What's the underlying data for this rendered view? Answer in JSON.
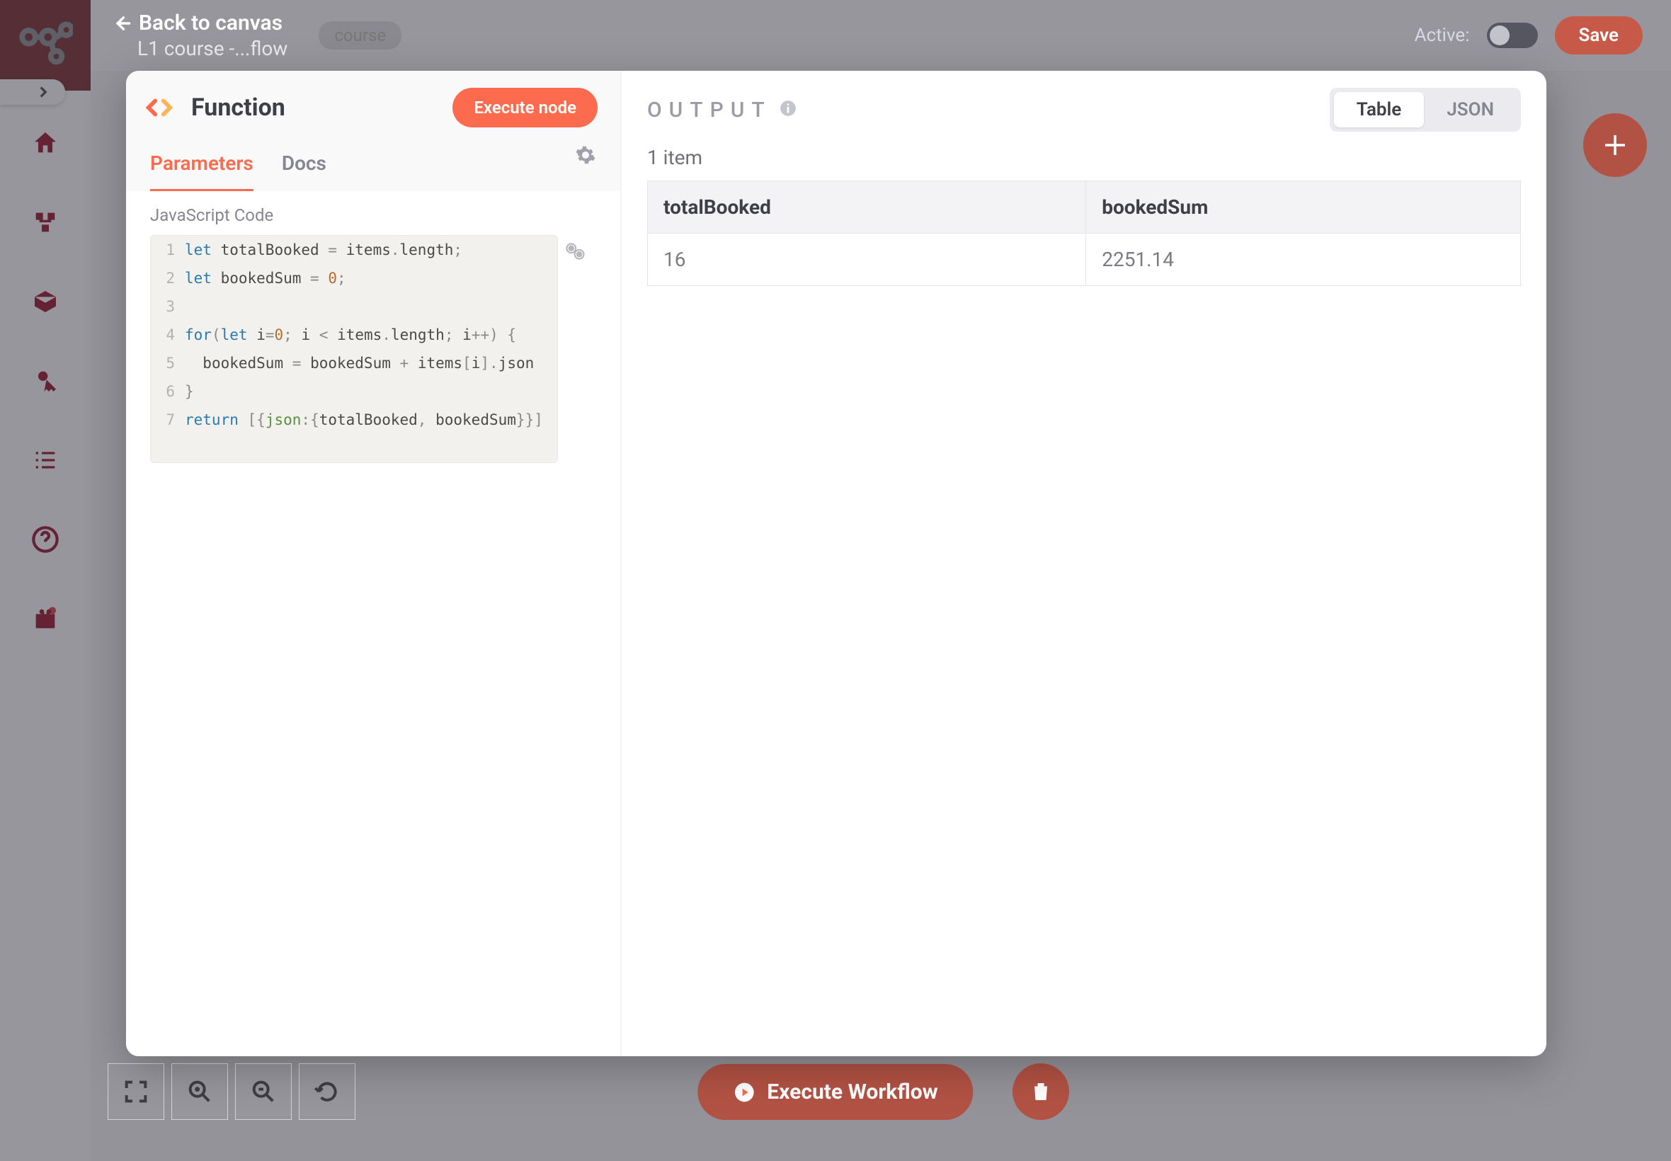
{
  "sidebar": {
    "items": [
      "home",
      "workflows",
      "packages",
      "credentials",
      "list",
      "help",
      "gift"
    ]
  },
  "topbar": {
    "back_label": "Back to canvas",
    "workflow_title": "L1 course -...flow",
    "tag": "course",
    "active_label": "Active:",
    "save_label": "Save"
  },
  "modal": {
    "node_title": "Function",
    "execute_label": "Execute node",
    "tabs": {
      "parameters": "Parameters",
      "docs": "Docs"
    },
    "code_label": "JavaScript Code",
    "code_lines": [
      {
        "n": "1",
        "seg": [
          [
            "kw",
            "let"
          ],
          [
            "sp",
            " "
          ],
          [
            "ident",
            "totalBooked"
          ],
          [
            "sp",
            " "
          ],
          [
            "punc",
            "="
          ],
          [
            "sp",
            " "
          ],
          [
            "ident",
            "items"
          ],
          [
            "punc",
            "."
          ],
          [
            "ident",
            "length"
          ],
          [
            "punc",
            ";"
          ]
        ]
      },
      {
        "n": "2",
        "seg": [
          [
            "kw",
            "let"
          ],
          [
            "sp",
            " "
          ],
          [
            "ident",
            "bookedSum"
          ],
          [
            "sp",
            " "
          ],
          [
            "punc",
            "="
          ],
          [
            "sp",
            " "
          ],
          [
            "num",
            "0"
          ],
          [
            "punc",
            ";"
          ]
        ]
      },
      {
        "n": "3",
        "seg": []
      },
      {
        "n": "4",
        "seg": [
          [
            "kw",
            "for"
          ],
          [
            "punc",
            "("
          ],
          [
            "kw",
            "let"
          ],
          [
            "sp",
            " "
          ],
          [
            "ident",
            "i"
          ],
          [
            "punc",
            "="
          ],
          [
            "num",
            "0"
          ],
          [
            "punc",
            ";"
          ],
          [
            "sp",
            " "
          ],
          [
            "ident",
            "i"
          ],
          [
            "sp",
            " "
          ],
          [
            "punc",
            "<"
          ],
          [
            "sp",
            " "
          ],
          [
            "ident",
            "items"
          ],
          [
            "punc",
            "."
          ],
          [
            "ident",
            "length"
          ],
          [
            "punc",
            ";"
          ],
          [
            "sp",
            " "
          ],
          [
            "ident",
            "i"
          ],
          [
            "punc",
            "++"
          ],
          [
            "punc",
            ")"
          ],
          [
            "sp",
            " "
          ],
          [
            "punc",
            "{"
          ]
        ]
      },
      {
        "n": "5",
        "seg": [
          [
            "sp",
            "  "
          ],
          [
            "ident",
            "bookedSum"
          ],
          [
            "sp",
            " "
          ],
          [
            "punc",
            "="
          ],
          [
            "sp",
            " "
          ],
          [
            "ident",
            "bookedSum"
          ],
          [
            "sp",
            " "
          ],
          [
            "punc",
            "+"
          ],
          [
            "sp",
            " "
          ],
          [
            "ident",
            "items"
          ],
          [
            "punc",
            "["
          ],
          [
            "ident",
            "i"
          ],
          [
            "punc",
            "]"
          ],
          [
            "punc",
            "."
          ],
          [
            "ident",
            "json"
          ]
        ]
      },
      {
        "n": "6",
        "seg": [
          [
            "punc",
            "}"
          ]
        ]
      },
      {
        "n": "7",
        "seg": [
          [
            "kw",
            "return"
          ],
          [
            "sp",
            " "
          ],
          [
            "punc",
            "["
          ],
          [
            "punc",
            "{"
          ],
          [
            "prop",
            "json"
          ],
          [
            "punc",
            ":"
          ],
          [
            "punc",
            "{"
          ],
          [
            "ident",
            "totalBooked"
          ],
          [
            "punc",
            ","
          ],
          [
            "sp",
            " "
          ],
          [
            "ident",
            "bookedSum"
          ],
          [
            "punc",
            "}"
          ],
          [
            "punc",
            "}"
          ],
          [
            "punc",
            "]"
          ]
        ]
      }
    ]
  },
  "output": {
    "label": "OUTPUT",
    "views": {
      "table": "Table",
      "json": "JSON"
    },
    "item_count": "1 item",
    "columns": [
      "totalBooked",
      "bookedSum"
    ],
    "rows": [
      [
        "16",
        "2251.14"
      ]
    ]
  },
  "bottom": {
    "execute_workflow": "Execute Workflow"
  },
  "chart_data": {
    "type": "table",
    "columns": [
      "totalBooked",
      "bookedSum"
    ],
    "rows": [
      [
        16,
        2251.14
      ]
    ]
  }
}
